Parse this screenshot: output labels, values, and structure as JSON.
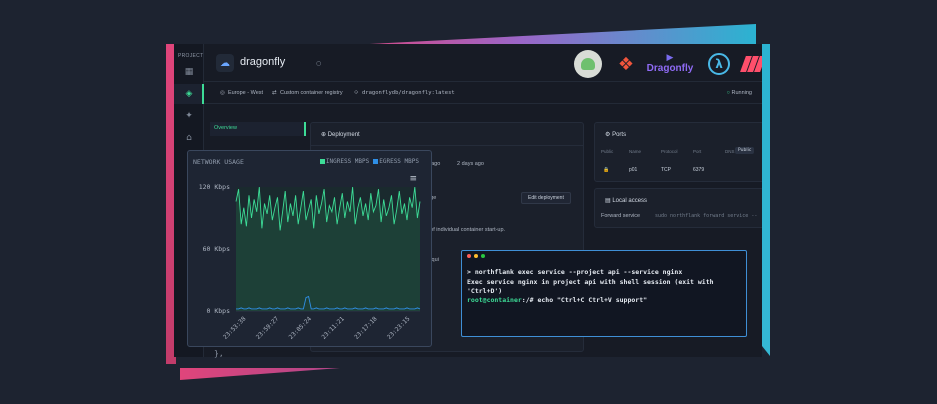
{
  "colors": {
    "accent": "#3ddc97",
    "ingress": "#3ddc97",
    "egress": "#2f8fe6",
    "terminal_border": "#3f8fd6",
    "stripe_pink": "#e0457b",
    "stripe_blue": "#2bb3d1"
  },
  "sidebar": {
    "section_label": "PROJECT",
    "icons": [
      "grid-icon",
      "layers-icon",
      "runner-icon",
      "home-icon"
    ]
  },
  "header": {
    "project_name": "dragonfly",
    "project_icon": "cloud-icon",
    "logos": [
      "dragonfly-logo",
      "Dragonfly"
    ]
  },
  "subbar": {
    "region": "Europe - West",
    "registry": "Custom container registry",
    "image": "dragonflydb/dragonfly:latest",
    "status": "Running"
  },
  "tabs": [
    {
      "label": "Overview",
      "active": true
    }
  ],
  "deployment": {
    "title": "Deployment",
    "time_a": "ays ago",
    "time_b": "2 days ago",
    "image_label": "Image",
    "edit_button": "Edit deployment",
    "startup_text": "me of individual container start-up.",
    "arg_text": "\"--requi"
  },
  "ports": {
    "title": "Ports",
    "headers": [
      "Public",
      "Name",
      "Protocol",
      "Port",
      "DNS"
    ],
    "public_pill": "Public",
    "row": {
      "name": "p01",
      "protocol": "TCP",
      "port": "6379"
    }
  },
  "local_access": {
    "title": "Local access",
    "label": "Forward service",
    "command": "sudo northflank forward service --"
  },
  "network_usage": {
    "title": "NETWORK USAGE",
    "legend_ingress": "INGRESS MBPS",
    "legend_egress": "EGRESS MBPS"
  },
  "chart_data": {
    "type": "line",
    "title": "NETWORK USAGE",
    "xlabel": "",
    "ylabel": "",
    "y_ticks": [
      "120 Kbps",
      "60 Kbps",
      "0 Kbps"
    ],
    "ylim": [
      0,
      120
    ],
    "x_ticks": [
      "23:53:38",
      "23:59:27",
      "23:05:24",
      "23:11:21",
      "23:17:18",
      "23:23:15"
    ],
    "series": [
      {
        "name": "INGRESS MBPS",
        "values": [
          106,
          118,
          84,
          100,
          82,
          112,
          90,
          108,
          96,
          120,
          80,
          104,
          94,
          112,
          88,
          100,
          110,
          78,
          96,
          116,
          86,
          104,
          92,
          112,
          84,
          100,
          116,
          88,
          98,
          108,
          80,
          112,
          94,
          104,
          118,
          86,
          102,
          96,
          110,
          84,
          100,
          114,
          90,
          106,
          96,
          120,
          84,
          100,
          110,
          92,
          104,
          88,
          114,
          96,
          102,
          118,
          86,
          108,
          92,
          100,
          112,
          84,
          98,
          116,
          94,
          104,
          88,
          110,
          100,
          120,
          90,
          106
        ]
      },
      {
        "name": "EGRESS MBPS",
        "values": [
          2,
          2,
          3,
          2,
          2,
          3,
          2,
          2,
          2,
          3,
          2,
          2,
          2,
          3,
          2,
          2,
          3,
          2,
          2,
          2,
          3,
          2,
          2,
          2,
          3,
          2,
          2,
          13,
          14,
          2,
          2,
          3,
          2,
          2,
          2,
          3,
          2,
          2,
          2,
          3,
          2,
          2,
          3,
          2,
          2,
          2,
          3,
          2,
          2,
          2,
          3,
          2,
          2,
          2,
          3,
          2,
          2,
          2,
          3,
          2,
          2,
          2,
          3,
          2,
          2,
          2,
          3,
          2,
          2,
          2,
          3,
          2
        ]
      }
    ],
    "grid": false,
    "legend": "top-right"
  },
  "terminal": {
    "line1": "> northflank exec service --project api --service nginx",
    "line2": "Exec service nginx in project api with shell session (exit with",
    "line3": "'Ctrl+D')",
    "prompt": "root@container",
    "line4_rest": ":/# echo \"Ctrl+C Ctrl+V support\""
  },
  "background_text": "},"
}
